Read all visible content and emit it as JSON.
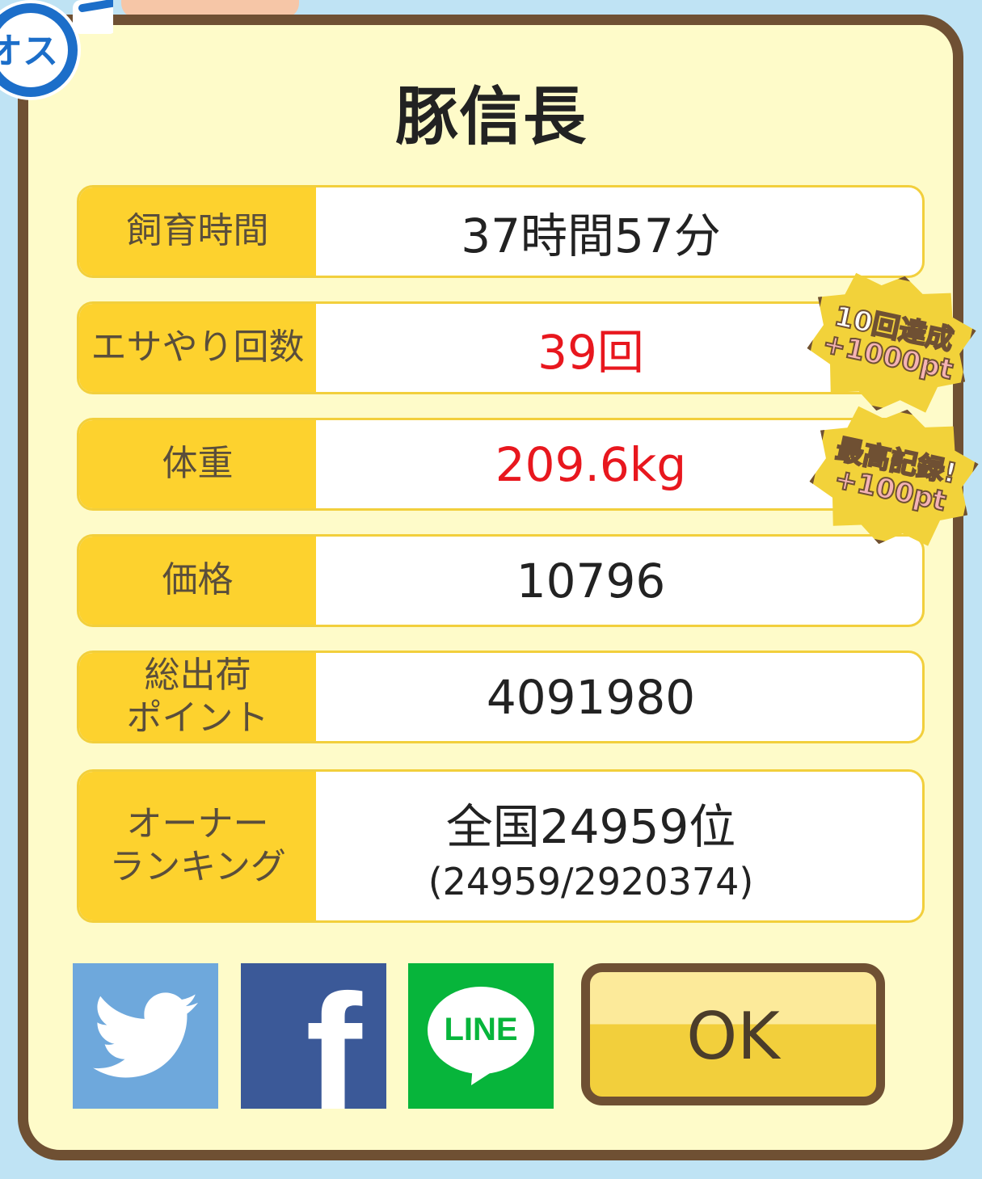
{
  "dialog": {
    "title": "豚信長"
  },
  "stats": [
    {
      "label": "飼育時間",
      "value": "37時間57分",
      "highlight": false
    },
    {
      "label": "エサやり回数",
      "value": "39回",
      "highlight": true
    },
    {
      "label": "体重",
      "value": "209.6kg",
      "highlight": true
    },
    {
      "label": "価格",
      "value": "10796",
      "highlight": false
    },
    {
      "label": "総出荷\nポイント",
      "value": "4091980",
      "highlight": false
    },
    {
      "label": "オーナー\nランキング",
      "value": "全国24959位",
      "sub": "(24959/2920374)",
      "highlight": false
    }
  ],
  "badges": [
    {
      "line1": "10回達成",
      "line2": "+1000pt"
    },
    {
      "line1": "最高記録!",
      "line2": "+100pt"
    }
  ],
  "gender": {
    "text": "オス"
  },
  "share": {
    "line_text": "LINE",
    "facebook_letter": "f"
  },
  "ok_button": {
    "label": "OK"
  },
  "colors": {
    "panel_bg": "#fefbc9",
    "border": "#6f5033",
    "label_bg": "#fdd22e",
    "highlight_text": "#e8171e",
    "twitter": "#6ea8dc",
    "facebook": "#3b5998",
    "line": "#07b53b"
  }
}
